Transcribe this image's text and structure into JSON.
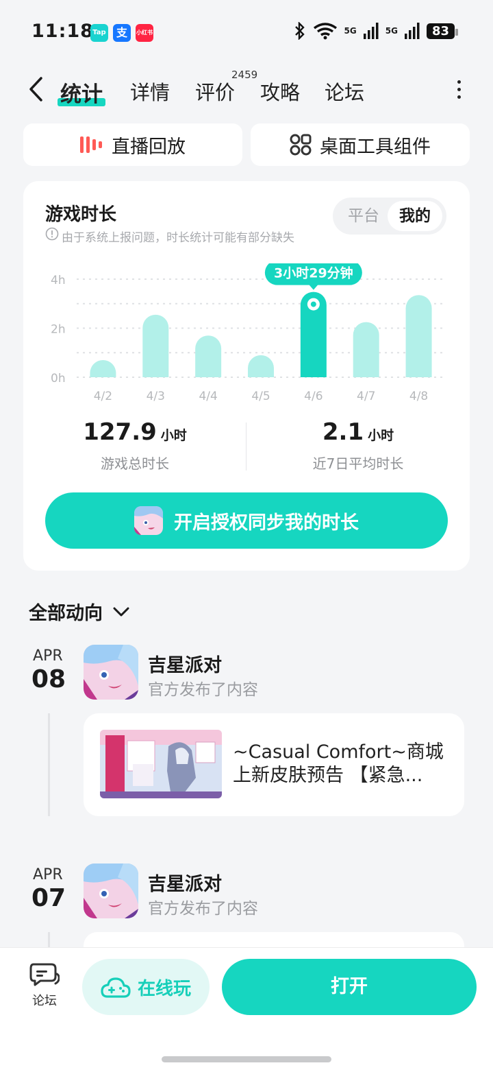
{
  "status_bar": {
    "time": "11:18",
    "apps": [
      "Tap",
      "支",
      "小红书"
    ],
    "network1": "5G",
    "network2": "5G",
    "battery": "83"
  },
  "nav": {
    "tabs": [
      "统计",
      "详情",
      "评价",
      "攻略",
      "论坛"
    ],
    "review_count": "2459"
  },
  "quick_actions": {
    "replay": "直播回放",
    "widgets": "桌面工具组件"
  },
  "play_time_card": {
    "title": "游戏时长",
    "notice": "由于系统上报问题，时长统计可能有部分缺失",
    "toggle_platform": "平台",
    "toggle_mine": "我的",
    "tooltip": "3小时29分钟",
    "total_value": "127.9",
    "total_unit": "小时",
    "total_label": "游戏总时长",
    "avg_value": "2.1",
    "avg_unit": "小时",
    "avg_label": "近7日平均时长",
    "cta": "开启授权同步我的时长"
  },
  "chart_data": {
    "type": "bar",
    "categories": [
      "4/2",
      "4/3",
      "4/4",
      "4/5",
      "4/6",
      "4/7",
      "4/8"
    ],
    "values": [
      0.7,
      2.55,
      1.7,
      0.9,
      3.48,
      2.25,
      3.35
    ],
    "highlight_index": 4,
    "y_ticks": [
      "0h",
      "2h",
      "4h"
    ],
    "ylim": [
      0,
      4
    ],
    "colors": {
      "bar": "#b2f0e9",
      "highlight": "#16d6c0"
    }
  },
  "feed": {
    "section_title": "全部动向",
    "items": [
      {
        "month": "APR",
        "day": "08",
        "game": "吉星派对",
        "desc": "官方发布了内容",
        "post": "~Casual Comfort~商城上新皮肤预告 【紧急..."
      },
      {
        "month": "APR",
        "day": "07",
        "game": "吉星派对",
        "desc": "官方发布了内容"
      }
    ]
  },
  "bottom_bar": {
    "forum": "论坛",
    "play_online": "在线玩",
    "open": "打开"
  },
  "colors": {
    "accent": "#16d6c0",
    "accent_light": "#b2f0e9"
  }
}
